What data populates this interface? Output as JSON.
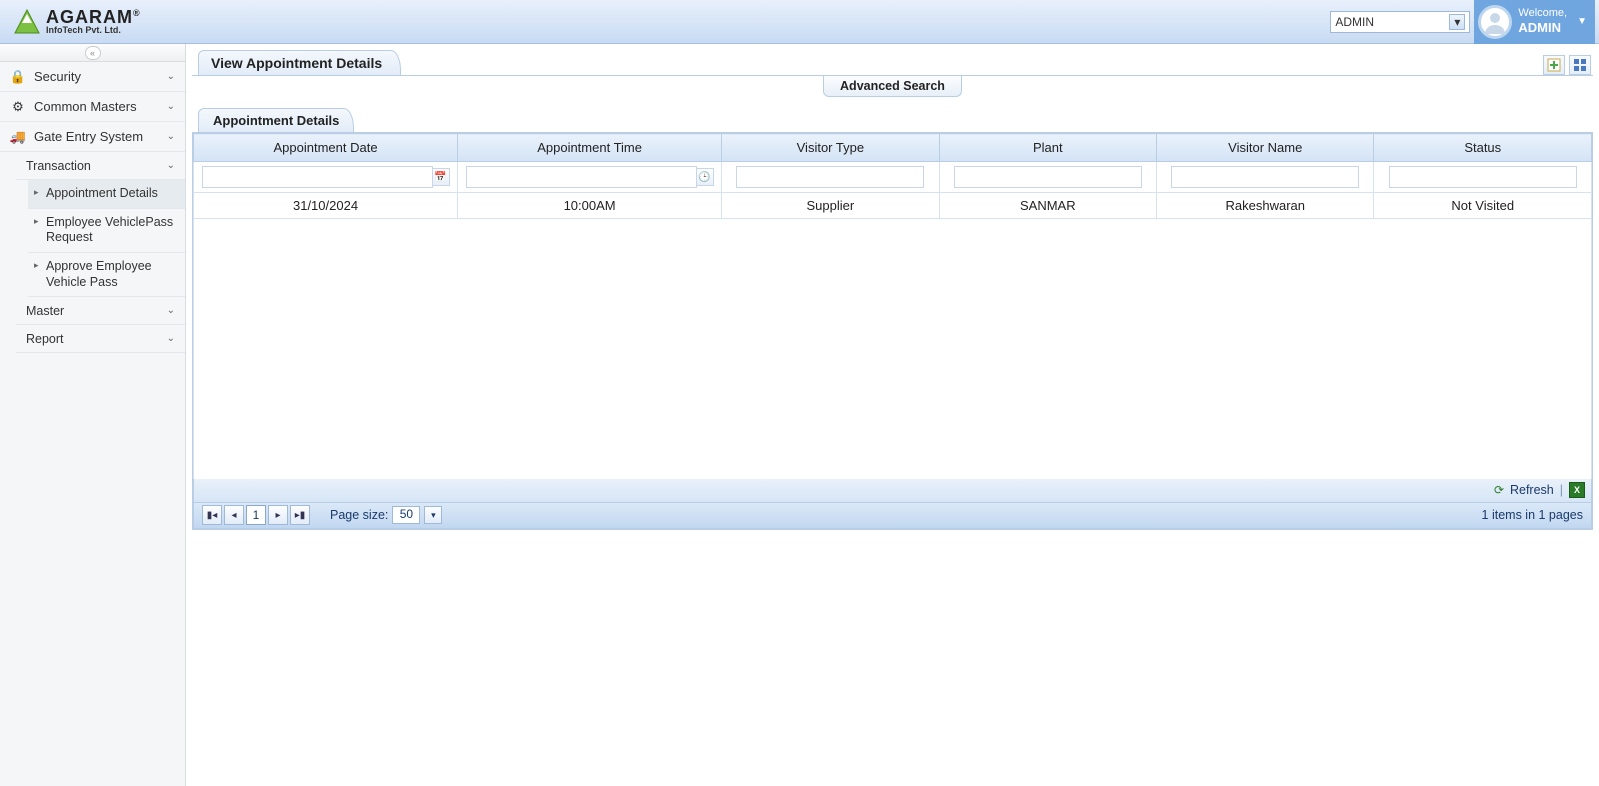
{
  "header": {
    "brand_line1": "AGARAM",
    "brand_line2": "InfoTech Pvt. Ltd.",
    "brand_reg": "®",
    "user_select": "ADMIN",
    "welcome_prefix": "Welcome,",
    "welcome_user": "ADMIN"
  },
  "sidebar": {
    "items": [
      {
        "label": "Security"
      },
      {
        "label": "Common Masters"
      },
      {
        "label": "Gate Entry System"
      }
    ],
    "transaction_label": "Transaction",
    "trans_children": [
      {
        "label": "Appointment Details"
      },
      {
        "label": "Employee VehiclePass Request"
      },
      {
        "label": "Approve Employee Vehicle Pass"
      }
    ],
    "master_label": "Master",
    "report_label": "Report"
  },
  "page": {
    "tab_title": "View Appointment Details",
    "advanced_search": "Advanced Search",
    "subtab_title": "Appointment Details"
  },
  "grid": {
    "columns": [
      "Appointment Date",
      "Appointment Time",
      "Visitor Type",
      "Plant",
      "Visitor Name",
      "Status"
    ],
    "filters": [
      "",
      "",
      "",
      "",
      "",
      ""
    ],
    "rows": [
      {
        "date": "31/10/2024",
        "time": "10:00AM",
        "visitor_type": "Supplier",
        "plant": "SANMAR",
        "visitor_name": "Rakeshwaran",
        "status": "Not Visited"
      }
    ]
  },
  "footer": {
    "refresh_label": "Refresh",
    "page_size_label": "Page size:",
    "page_size_value": "50",
    "current_page": "1",
    "items_info": "1 items in 1 pages"
  }
}
